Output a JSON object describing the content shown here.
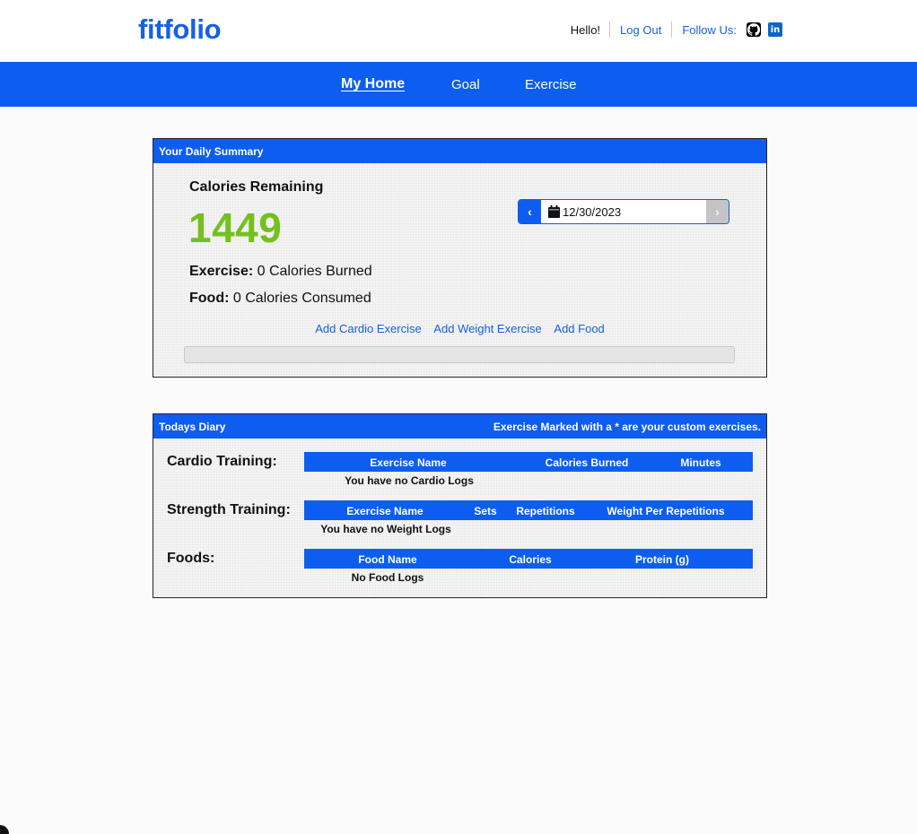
{
  "header": {
    "logo": "fitfolio",
    "greeting": "Hello!",
    "logout_label": "Log Out",
    "follow_label": "Follow Us:",
    "social_icons": [
      "github-icon",
      "linkedin-icon"
    ],
    "linkedin_glyph": "in"
  },
  "nav": {
    "items": [
      {
        "label": "My Home",
        "active": true
      },
      {
        "label": "Goal",
        "active": false
      },
      {
        "label": "Exercise",
        "active": false
      }
    ]
  },
  "summary": {
    "panel_title": "Your Daily Summary",
    "calories_label": "Calories Remaining",
    "calories_value": "1449",
    "exercise_label": "Exercise:",
    "exercise_value": "0 Calories Burned",
    "food_label": "Food:",
    "food_value": "0 Calories Consumed",
    "date_value": "12/30/2023",
    "prev_glyph": "‹",
    "next_glyph": "›",
    "links": {
      "add_cardio": "Add Cardio Exercise",
      "add_weight": "Add Weight Exercise",
      "add_food": "Add Food"
    },
    "progress_fraction": 0
  },
  "diary": {
    "panel_title": "Todays Diary",
    "note": "Exercise Marked with a * are your custom exercises.",
    "cardio": {
      "label": "Cardio Training:",
      "columns": [
        "Exercise Name",
        "Calories Burned",
        "Minutes"
      ],
      "empty": "You have no Cardio Logs"
    },
    "strength": {
      "label": "Strength Training:",
      "columns": [
        "Exercise Name",
        "Sets",
        "Repetitions",
        "Weight Per Repetitions"
      ],
      "empty": "You have no Weight Logs"
    },
    "foods": {
      "label": "Foods:",
      "columns": [
        "Food Name",
        "Calories",
        "Protein (g)"
      ],
      "empty": "No Food Logs"
    }
  },
  "colors": {
    "brand_blue": "#0d5df0",
    "link_blue": "#1560e3",
    "calories_green": "#74c01d"
  }
}
